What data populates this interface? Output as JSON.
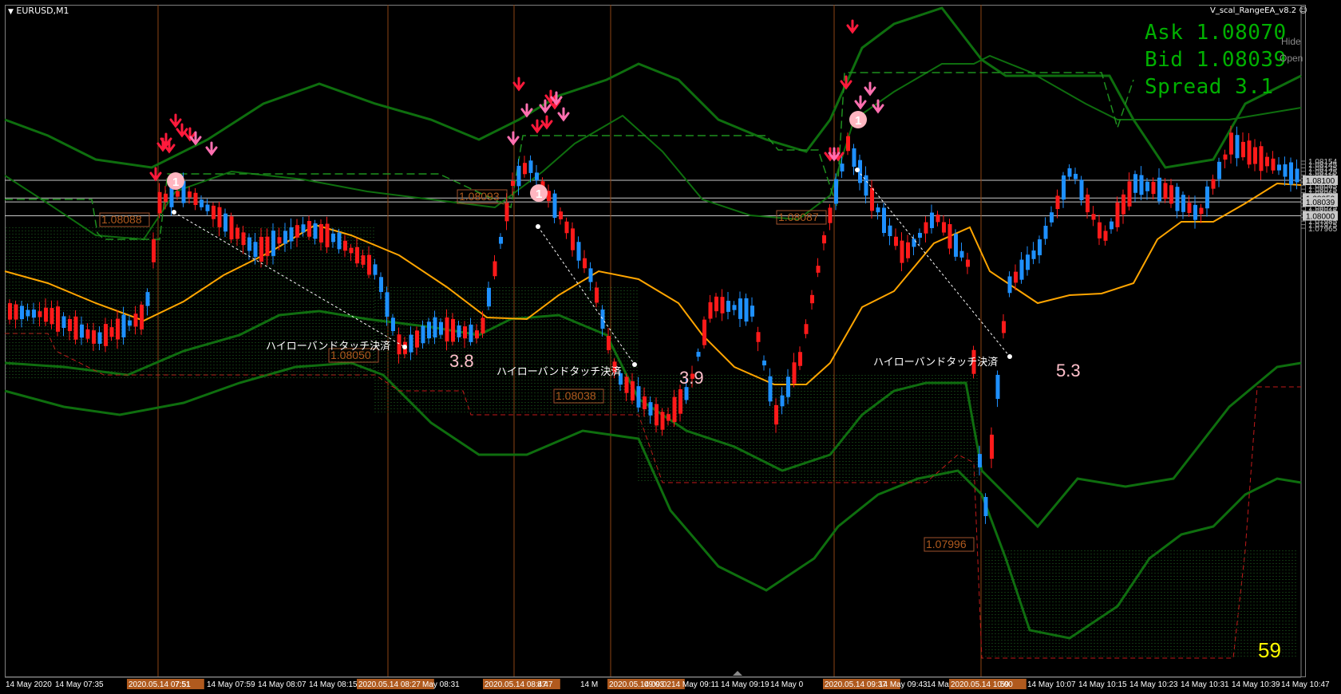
{
  "window": {
    "title": "EURUSD,M1",
    "ea_name": "V_scal_RangeEA_v8.2"
  },
  "quotes": {
    "ask": "Ask 1.08070",
    "bid": "Bid 1.08039",
    "spread": "Spread 3.1"
  },
  "buttons": {
    "hide": "Hide",
    "open": "Open"
  },
  "countdown": "59",
  "price_axis": {
    "ticks": [
      "1.08154",
      "1.08145",
      "1.08135",
      "1.08125",
      "1.08115",
      "1.08105",
      "1.08095",
      "1.08085",
      "1.08075",
      "1.08065",
      "1.08055",
      "1.08045",
      "1.08035",
      "1.08025",
      "1.08015",
      "1.08005",
      "1.07995",
      "1.07985",
      "1.07975",
      "1.07965"
    ],
    "markers": [
      "1.08100",
      "1.08050",
      "1.08039",
      "1.08000"
    ]
  },
  "time_axis": {
    "labels": [
      "14 May 2020",
      "14 May 07:35",
      "14 Ma",
      "2020.05.14 07:51",
      "7:51",
      "14 May 07:59",
      "14 May 08:07",
      "14 May 08:15",
      "2020.05.14 08:27",
      "May 08:31",
      "2020.05.14 08:47",
      "8:47",
      "14 M",
      "2020.05.14 09:02",
      "09:03",
      "14 May 09:11",
      "14 May 09:19",
      "14 May 0",
      "2020.05.14 09:37",
      "14 May 09:43",
      "14 May",
      "2020.05.14 10:00",
      "59",
      "14 May 10:07",
      "14 May 10:15",
      "14 May 10:23",
      "14 May 10:31",
      "14 May 10:39",
      "14 May 10:47"
    ]
  },
  "level_labels": [
    "1.08088",
    "1.08093",
    "1.08087",
    "1.08050",
    "1.08038",
    "1.07996"
  ],
  "annotations": {
    "exits": [
      "ハイローバンドタッチ決済",
      "ハイローバンドタッチ決済",
      "ハイローバンドタッチ決済"
    ],
    "pips": [
      "3.8",
      "3.9",
      "5.3"
    ],
    "entry_mark": "1"
  },
  "colors": {
    "background": "#000000",
    "bull": "#1e90ff",
    "bear": "#ff1a1a",
    "band": "#0e6e0e",
    "ma": "#ffa500",
    "quote": "#00b000",
    "countdown": "#ffff00",
    "vline": "#8b4513",
    "label_border": "#a0522d"
  }
}
